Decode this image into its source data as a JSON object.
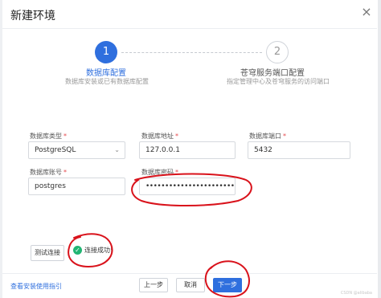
{
  "dialog": {
    "title": "新建环境",
    "close_glyph": "×"
  },
  "steps": [
    {
      "number": "1",
      "title": "数据库配置",
      "desc": "数据库安装或已有数据库配置",
      "state": "active"
    },
    {
      "number": "2",
      "title": "苍穹服务端口配置",
      "desc": "指定管理中心及苍穹服务的访问端口",
      "state": "pending"
    }
  ],
  "form": {
    "required_mark": "*",
    "db_type": {
      "label": "数据库类型",
      "value": "PostgreSQL",
      "caret": "⌄"
    },
    "db_address": {
      "label": "数据库地址",
      "value": "127.0.0.1"
    },
    "db_port": {
      "label": "数据库端口",
      "value": "5432"
    },
    "db_user": {
      "label": "数据库账号",
      "value": "postgres"
    },
    "db_password": {
      "label": "数据库密码",
      "value": "••••••••••••••••••••••••••••••"
    }
  },
  "test": {
    "button_label": "测试连接",
    "result_icon": "check-circle-icon",
    "result_glyph": "✓",
    "result_text": "连接成功!"
  },
  "footer": {
    "guide_link": "查看安装使用指引",
    "prev_label": "上一步",
    "cancel_label": "取消",
    "next_label": "下一步",
    "watermark": "CSDN @alibaba"
  },
  "colors": {
    "primary": "#2f6fde",
    "success": "#22b573",
    "required": "#e5484d",
    "annotation": "#d9121b"
  }
}
